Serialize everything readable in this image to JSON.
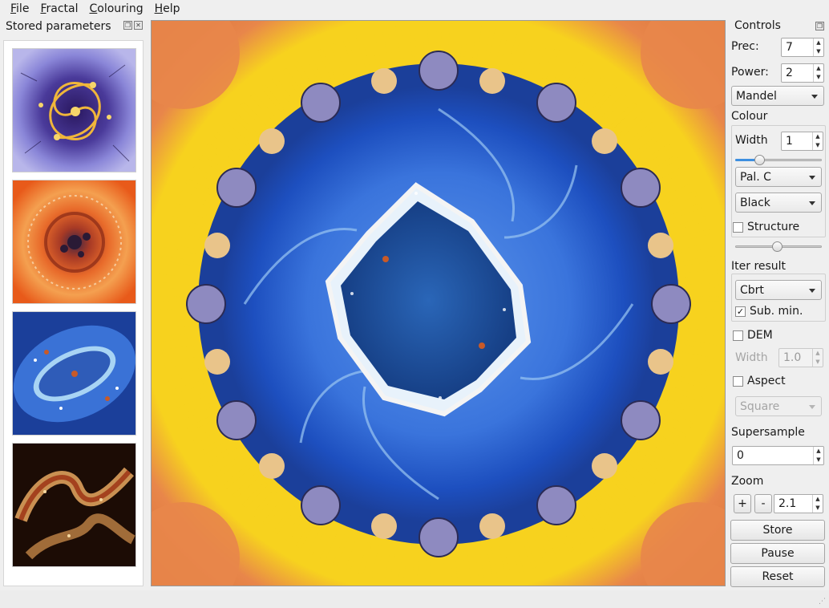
{
  "menubar": {
    "items": [
      {
        "acc": "F",
        "rest": "ile"
      },
      {
        "acc": "F",
        "rest": "ractal"
      },
      {
        "acc": "C",
        "rest": "olouring"
      },
      {
        "acc": "H",
        "rest": "elp"
      }
    ]
  },
  "left_dock": {
    "title": "Stored parameters",
    "thumbnails": [
      {
        "name": "thumb-purple-spiral",
        "bg": "#7b76c9",
        "accent": "#f0b63a"
      },
      {
        "name": "thumb-orange-disc",
        "bg": "#e86a2a",
        "accent": "#3b2545"
      },
      {
        "name": "thumb-blue-star",
        "bg": "#2e5fc0",
        "accent": "#c85a28"
      },
      {
        "name": "thumb-dark-gold",
        "bg": "#2a1408",
        "accent": "#e8a860"
      }
    ]
  },
  "controls": {
    "title": "Controls",
    "prec_label": "Prec:",
    "prec_value": "7",
    "power_label": "Power:",
    "power_value": "2",
    "fractal_type": "Mandel",
    "colour_label": "Colour",
    "width_label": "Width",
    "width_value": "1",
    "width_slider_fraction": 0.25,
    "palette": "Pal. C",
    "background": "Black",
    "structure_label": "Structure",
    "structure_checked": false,
    "structure_slider_fraction": 0.48,
    "iter_result_label": "Iter result",
    "iter_result": "Cbrt",
    "sub_min_label": "Sub. min.",
    "sub_min_checked": true,
    "dem_label": "DEM",
    "dem_checked": false,
    "dem_width_label": "Width",
    "dem_width_value": "1.0",
    "aspect_label": "Aspect",
    "aspect_checked": false,
    "aspect_value": "Square",
    "supersample_label": "Supersample",
    "supersample_value": "0",
    "zoom_label": "Zoom",
    "zoom_plus": "+",
    "zoom_minus": "-",
    "zoom_value": "2.1",
    "store_label": "Store",
    "pause_label": "Pause",
    "reset_label": "Reset"
  },
  "colors": {
    "fractal_outer": "#e8864a",
    "fractal_yellow": "#f7d21e",
    "fractal_blue": "#2a63d3",
    "fractal_core": "#1b4e9a",
    "accent_blue": "#3d8fe0"
  }
}
